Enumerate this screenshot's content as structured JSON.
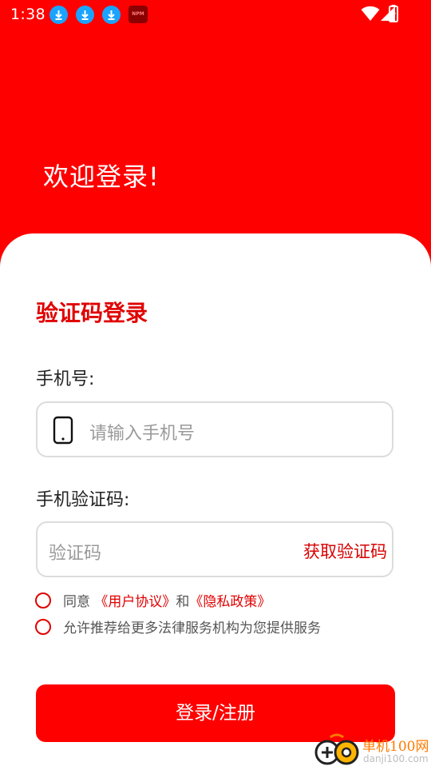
{
  "statusbar": {
    "time": "1:38",
    "notification_icons": [
      "download-icon",
      "download-icon",
      "download-icon",
      "npm-app-icon"
    ],
    "npm_badge": "NPM",
    "system_icons": [
      "wifi-icon",
      "cellular-signal-icon",
      "battery-charging-icon"
    ]
  },
  "header": {
    "welcome_text": "欢迎登录!"
  },
  "card": {
    "title": "验证码登录",
    "phone_label": "手机号:",
    "phone_placeholder": "请输入手机号",
    "code_label": "手机验证码:",
    "code_placeholder": "验证码",
    "get_code_label": "获取验证码"
  },
  "agreements": {
    "agree_prefix": "同意",
    "user_agreement": "《用户协议》",
    "and": "和",
    "privacy_policy": "《隐私政策》",
    "allow_recommend": "允许推荐给更多法律服务机构为您提供服务"
  },
  "submit_label": "登录/注册",
  "watermark": {
    "name": "单机100网",
    "url": "danji100.com"
  },
  "colors": {
    "primary": "#ff0000",
    "accent_text": "#e00000",
    "download_badge": "#1aa3ff"
  }
}
